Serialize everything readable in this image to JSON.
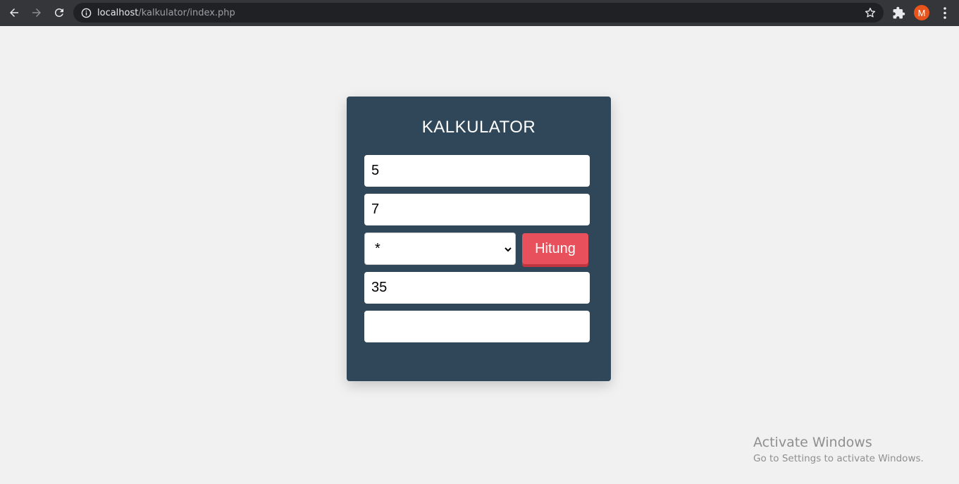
{
  "browser": {
    "url_host": "localhost",
    "url_path": "/kalkulator/index.php",
    "profile_initial": "M",
    "profile_color": "#e8541c"
  },
  "calculator": {
    "title": "KALKULATOR",
    "number1": "5",
    "number2": "7",
    "operator": "*",
    "button_label": "Hitung",
    "result": "35",
    "extra_field": "",
    "card_color": "#2f4759",
    "button_color": "#e8505b"
  },
  "watermark": {
    "title": "Activate Windows",
    "subtitle": "Go to Settings to activate Windows."
  }
}
